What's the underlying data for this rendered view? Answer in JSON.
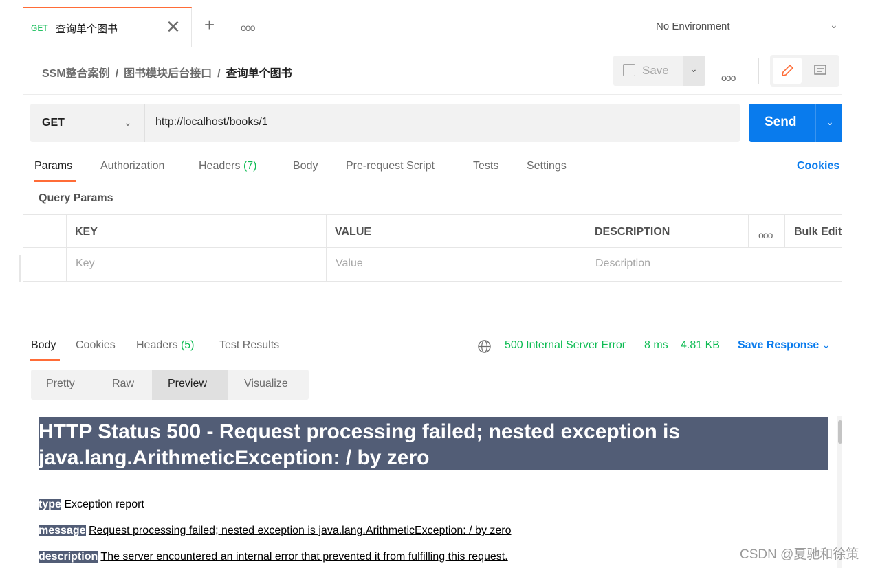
{
  "tab": {
    "method": "GET",
    "name": "查询单个图书",
    "close": "✕",
    "new": "+",
    "more": "ooo"
  },
  "environment": {
    "label": "No Environment",
    "chevron": "⌄"
  },
  "breadcrumb": {
    "collection": "SSM整合案例",
    "folder": "图书模块后台接口",
    "request": "查询单个图书",
    "separator": "/"
  },
  "toolbar": {
    "save_label": "Save",
    "more": "ooo"
  },
  "request": {
    "method": "GET",
    "url": "http://localhost/books/1",
    "send_label": "Send",
    "tabs": {
      "params": "Params",
      "authorization": "Authorization",
      "headers": "Headers",
      "headers_count": "(7)",
      "body": "Body",
      "prerequest": "Pre-request Script",
      "tests": "Tests",
      "settings": "Settings"
    },
    "cookies": "Cookies"
  },
  "query_params": {
    "title": "Query Params",
    "columns": {
      "key": "KEY",
      "value": "VALUE",
      "description": "DESCRIPTION",
      "more": "ooo",
      "bulk_edit": "Bulk Edit"
    },
    "placeholders": {
      "key": "Key",
      "value": "Value",
      "description": "Description"
    }
  },
  "response": {
    "tabs": {
      "body": "Body",
      "cookies": "Cookies",
      "headers": "Headers",
      "headers_count": "(5)",
      "test_results": "Test Results"
    },
    "status": "500 Internal Server Error",
    "time": "8 ms",
    "size": "4.81 KB",
    "save_response": "Save Response",
    "views": {
      "pretty": "Pretty",
      "raw": "Raw",
      "preview": "Preview",
      "visualize": "Visualize"
    }
  },
  "preview": {
    "heading": "HTTP Status 500 - Request processing failed; nested exception is java.lang.ArithmeticException: / by zero",
    "type_label": "type",
    "type_value": "Exception report",
    "message_label": "message",
    "message_value": "Request processing failed; nested exception is java.lang.ArithmeticException: / by zero",
    "description_label": "description",
    "description_value": "The server encountered an internal error that prevented it from fulfilling this request."
  },
  "watermark": "CSDN @夏驰和徐策",
  "colors": {
    "accent": "#ff6c37",
    "primary": "#097bed",
    "success": "#0cbb52",
    "tomcat": "#525d76"
  }
}
